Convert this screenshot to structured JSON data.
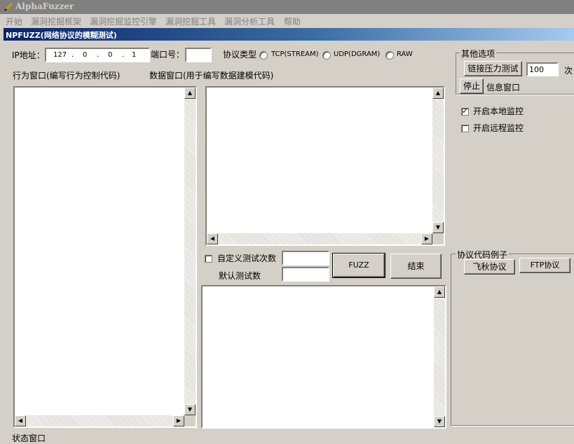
{
  "window": {
    "title": "AlphaFuzzer"
  },
  "menu": [
    "开始",
    "漏洞挖掘框架",
    "漏洞挖掘监控引擎",
    "漏洞挖掘工具",
    "漏洞分析工具",
    "帮助"
  ],
  "panel": {
    "title": "NPFUZZ(网络协议的模糊测试)"
  },
  "ip": {
    "label": "IP地址：",
    "octets": [
      "127",
      "0",
      "0",
      "1"
    ],
    "dots": [
      ".",
      ".",
      "."
    ]
  },
  "port": {
    "label": "端口号：",
    "value": ""
  },
  "protocol": {
    "label": "协议类型",
    "options": [
      "TCP(STREAM)",
      "UDP(DGRAM)",
      "RAW"
    ],
    "selected": null
  },
  "behavior_window": {
    "label": "行为窗口(编写行为控制代码)"
  },
  "data_window": {
    "label": "数据窗口(用于编写数据建模代码)"
  },
  "custom_count": {
    "label": "自定义测试次数",
    "checked": false,
    "value": ""
  },
  "default_count": {
    "label": "默认测试数",
    "value": ""
  },
  "buttons": {
    "fuzz": "FUZZ",
    "end": "结束"
  },
  "other_options": {
    "title": "其他选项",
    "stress_button": "链接压力测试",
    "stress_count": "100",
    "times_unit": "次",
    "stop_button": "停止",
    "info_label": "信息窗口",
    "local_monitor": {
      "label": "开启本地监控",
      "checked": true
    },
    "remote_monitor": {
      "label": "开启远程监控",
      "checked": false
    }
  },
  "protocol_examples": {
    "title": "协议代码例子",
    "feiqiu_button": "飞秋协议",
    "ftp_button": "FTP协议"
  },
  "status_window": {
    "label": "状态窗口"
  }
}
